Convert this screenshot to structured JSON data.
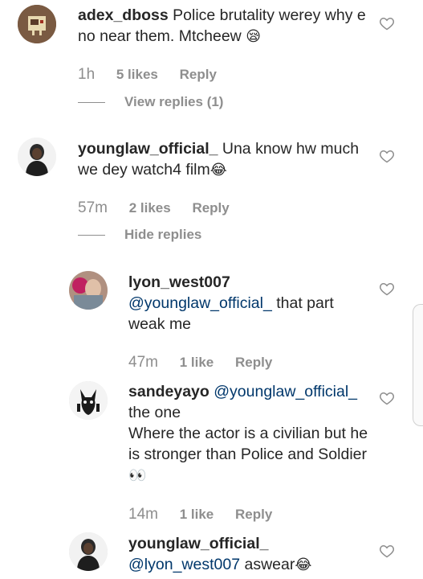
{
  "comments": [
    {
      "user": "adex_dboss",
      "text": "Police brutality werey why e no near them. Mtcheew",
      "emoji": "😪",
      "time": "1h",
      "likes": "5 likes",
      "reply": "Reply",
      "replies_toggle": "View replies (1)"
    },
    {
      "user": "younglaw_official_",
      "text": "Una know hw much we dey watch4 film",
      "emoji": "😂",
      "time": "57m",
      "likes": "2 likes",
      "reply": "Reply",
      "replies_toggle": "Hide replies"
    },
    {
      "user": "lyon_west007",
      "mention": "@younglaw_official_",
      "text": "that part weak me",
      "time": "47m",
      "likes": "1 like",
      "reply": "Reply"
    },
    {
      "user": "sandeyayo",
      "mention": "@younglaw_official_",
      "text_line1": "the one",
      "text_line2": "Where the actor is a civilian but he is stronger than Police and Soldier",
      "emoji": "👀",
      "time": "14m",
      "likes": "1 like",
      "reply": "Reply"
    },
    {
      "user": "younglaw_official_",
      "mention": "@lyon_west007",
      "text": "aswear",
      "emoji": "😂"
    }
  ],
  "icons": {
    "heart": "heart-outline-icon",
    "avatar": "user-avatar"
  },
  "colors": {
    "text": "#262626",
    "meta": "#8e8e8e",
    "mention": "#00376b"
  }
}
